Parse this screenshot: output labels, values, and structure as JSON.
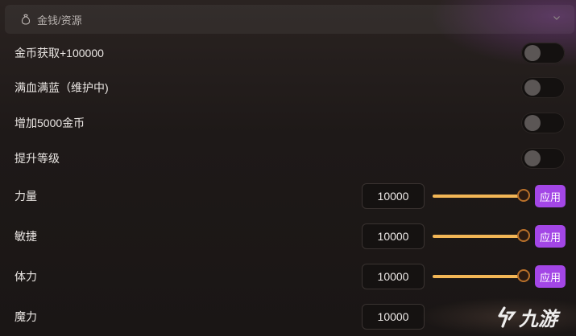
{
  "section": {
    "icon": "money-bag-icon",
    "title": "金钱/资源"
  },
  "toggles": [
    {
      "label": "金币获取+100000",
      "on": false
    },
    {
      "label": "满血满蓝（维护中)",
      "on": false
    },
    {
      "label": "增加5000金币",
      "on": false
    },
    {
      "label": "提升等级",
      "on": false
    }
  ],
  "attributes": [
    {
      "label": "力量",
      "value": "10000",
      "level": 1.0,
      "apply_label": "应用"
    },
    {
      "label": "敏捷",
      "value": "10000",
      "level": 1.0,
      "apply_label": "应用"
    },
    {
      "label": "体力",
      "value": "10000",
      "level": 1.0,
      "apply_label": "应用"
    },
    {
      "label": "魔力",
      "value": "10000"
    }
  ],
  "colors": {
    "accent": "#a346e6",
    "slider_fill": "#f2b656"
  },
  "watermark": {
    "text": "九游"
  }
}
